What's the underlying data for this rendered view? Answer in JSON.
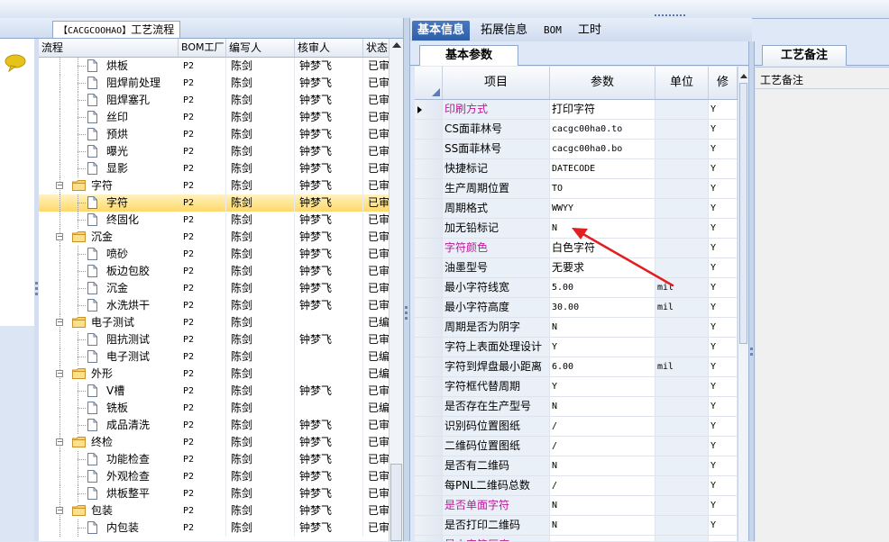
{
  "left_panel": {
    "tab_title_code": "【CACGCOOHAO】",
    "tab_title_text": "工艺流程",
    "columns": [
      "流程",
      "BOM工厂",
      "编写人",
      "核审人",
      "状态"
    ],
    "rows": [
      {
        "level": 2,
        "type": "doc",
        "name": "烘板",
        "bom": "P2",
        "author": "陈剑",
        "reviewer": "钟梦飞",
        "status": "已审"
      },
      {
        "level": 2,
        "type": "doc",
        "name": "阻焊前处理",
        "bom": "P2",
        "author": "陈剑",
        "reviewer": "钟梦飞",
        "status": "已审"
      },
      {
        "level": 2,
        "type": "doc",
        "name": "阻焊塞孔",
        "bom": "P2",
        "author": "陈剑",
        "reviewer": "钟梦飞",
        "status": "已审"
      },
      {
        "level": 2,
        "type": "doc",
        "name": "丝印",
        "bom": "P2",
        "author": "陈剑",
        "reviewer": "钟梦飞",
        "status": "已审"
      },
      {
        "level": 2,
        "type": "doc",
        "name": "预烘",
        "bom": "P2",
        "author": "陈剑",
        "reviewer": "钟梦飞",
        "status": "已审"
      },
      {
        "level": 2,
        "type": "doc",
        "name": "曝光",
        "bom": "P2",
        "author": "陈剑",
        "reviewer": "钟梦飞",
        "status": "已审"
      },
      {
        "level": 2,
        "type": "doc",
        "name": "显影",
        "bom": "P2",
        "author": "陈剑",
        "reviewer": "钟梦飞",
        "status": "已审"
      },
      {
        "level": 1,
        "type": "folder",
        "name": "字符",
        "bom": "P2",
        "author": "陈剑",
        "reviewer": "钟梦飞",
        "status": "已审"
      },
      {
        "level": 2,
        "type": "doc",
        "name": "字符",
        "bom": "P2",
        "author": "陈剑",
        "reviewer": "钟梦飞",
        "status": "已审",
        "selected": true
      },
      {
        "level": 2,
        "type": "doc",
        "name": "终固化",
        "bom": "P2",
        "author": "陈剑",
        "reviewer": "钟梦飞",
        "status": "已审"
      },
      {
        "level": 1,
        "type": "folder",
        "name": "沉金",
        "bom": "P2",
        "author": "陈剑",
        "reviewer": "钟梦飞",
        "status": "已审"
      },
      {
        "level": 2,
        "type": "doc",
        "name": "喷砂",
        "bom": "P2",
        "author": "陈剑",
        "reviewer": "钟梦飞",
        "status": "已审"
      },
      {
        "level": 2,
        "type": "doc",
        "name": "板边包胶",
        "bom": "P2",
        "author": "陈剑",
        "reviewer": "钟梦飞",
        "status": "已审"
      },
      {
        "level": 2,
        "type": "doc",
        "name": "沉金",
        "bom": "P2",
        "author": "陈剑",
        "reviewer": "钟梦飞",
        "status": "已审"
      },
      {
        "level": 2,
        "type": "doc",
        "name": "水洗烘干",
        "bom": "P2",
        "author": "陈剑",
        "reviewer": "钟梦飞",
        "status": "已审"
      },
      {
        "level": 1,
        "type": "folder",
        "name": "电子测试",
        "bom": "P2",
        "author": "陈剑",
        "reviewer": "",
        "status": "已编"
      },
      {
        "level": 2,
        "type": "doc",
        "name": "阻抗测试",
        "bom": "P2",
        "author": "陈剑",
        "reviewer": "钟梦飞",
        "status": "已审"
      },
      {
        "level": 2,
        "type": "doc",
        "name": "电子测试",
        "bom": "P2",
        "author": "陈剑",
        "reviewer": "",
        "status": "已编"
      },
      {
        "level": 1,
        "type": "folder",
        "name": "外形",
        "bom": "P2",
        "author": "陈剑",
        "reviewer": "",
        "status": "已编"
      },
      {
        "level": 2,
        "type": "doc",
        "name": "V槽",
        "bom": "P2",
        "author": "陈剑",
        "reviewer": "钟梦飞",
        "status": "已审"
      },
      {
        "level": 2,
        "type": "doc",
        "name": "铣板",
        "bom": "P2",
        "author": "陈剑",
        "reviewer": "",
        "status": "已编"
      },
      {
        "level": 2,
        "type": "doc",
        "name": "成品清洗",
        "bom": "P2",
        "author": "陈剑",
        "reviewer": "钟梦飞",
        "status": "已审"
      },
      {
        "level": 1,
        "type": "folder",
        "name": "终检",
        "bom": "P2",
        "author": "陈剑",
        "reviewer": "钟梦飞",
        "status": "已审"
      },
      {
        "level": 2,
        "type": "doc",
        "name": "功能检查",
        "bom": "P2",
        "author": "陈剑",
        "reviewer": "钟梦飞",
        "status": "已审"
      },
      {
        "level": 2,
        "type": "doc",
        "name": "外观检查",
        "bom": "P2",
        "author": "陈剑",
        "reviewer": "钟梦飞",
        "status": "已审"
      },
      {
        "level": 2,
        "type": "doc",
        "name": "烘板整平",
        "bom": "P2",
        "author": "陈剑",
        "reviewer": "钟梦飞",
        "status": "已审"
      },
      {
        "level": 1,
        "type": "folder",
        "name": "包装",
        "bom": "P2",
        "author": "陈剑",
        "reviewer": "钟梦飞",
        "status": "已审"
      },
      {
        "level": 2,
        "type": "doc",
        "name": "内包装",
        "bom": "P2",
        "author": "陈剑",
        "reviewer": "钟梦飞",
        "status": "已审"
      }
    ]
  },
  "middle_panel": {
    "tabs": [
      {
        "label": "基本信息",
        "active": true
      },
      {
        "label": "拓展信息",
        "active": false
      },
      {
        "label": "BOM",
        "active": false
      },
      {
        "label": "工时",
        "active": false
      }
    ],
    "subtab": "基本参数",
    "columns": [
      "项目",
      "参数",
      "单位",
      "修"
    ],
    "rows": [
      {
        "item": "印刷方式",
        "value": "打印字符",
        "unit": "",
        "edit": "Y",
        "pink": true,
        "current": true
      },
      {
        "item": "CS面菲林号",
        "value": "cacgc00ha0.to",
        "unit": "",
        "edit": "Y"
      },
      {
        "item": "SS面菲林号",
        "value": "cacgc00ha0.bo",
        "unit": "",
        "edit": "Y"
      },
      {
        "item": "快捷标记",
        "value": "DATECODE",
        "unit": "",
        "edit": "Y"
      },
      {
        "item": "生产周期位置",
        "value": "TO",
        "unit": "",
        "edit": "Y"
      },
      {
        "item": "周期格式",
        "value": "WWYY",
        "unit": "",
        "edit": "Y"
      },
      {
        "item": "加无铅标记",
        "value": "N",
        "unit": "",
        "edit": "Y"
      },
      {
        "item": "字符颜色",
        "value": "白色字符",
        "unit": "",
        "edit": "Y",
        "pink": true
      },
      {
        "item": "油墨型号",
        "value": "无要求",
        "unit": "",
        "edit": "Y"
      },
      {
        "item": "最小字符线宽",
        "value": "5.00",
        "unit": "mil",
        "edit": "Y"
      },
      {
        "item": "最小字符高度",
        "value": "30.00",
        "unit": "mil",
        "edit": "Y"
      },
      {
        "item": "周期是否为阴字",
        "value": "N",
        "unit": "",
        "edit": "Y"
      },
      {
        "item": "字符上表面处理设计",
        "value": "Y",
        "unit": "",
        "edit": "Y"
      },
      {
        "item": "字符到焊盘最小距离",
        "value": "6.00",
        "unit": "mil",
        "edit": "Y"
      },
      {
        "item": "字符框代替周期",
        "value": "Y",
        "unit": "",
        "edit": "Y"
      },
      {
        "item": "是否存在生产型号",
        "value": "N",
        "unit": "",
        "edit": "Y"
      },
      {
        "item": "识别码位置图纸",
        "value": "/",
        "unit": "",
        "edit": "Y"
      },
      {
        "item": "二维码位置图纸",
        "value": "/",
        "unit": "",
        "edit": "Y"
      },
      {
        "item": "是否有二维码",
        "value": "N",
        "unit": "",
        "edit": "Y"
      },
      {
        "item": "每PNL二维码总数",
        "value": "/",
        "unit": "",
        "edit": "Y"
      },
      {
        "item": "是否单面字符",
        "value": "N",
        "unit": "",
        "edit": "Y",
        "pink": true
      },
      {
        "item": "是否打印二维码",
        "value": "N",
        "unit": "",
        "edit": "Y"
      },
      {
        "item": "最小字符厚度",
        "value": "/",
        "unit": "",
        "edit": "Y",
        "pink": true
      }
    ]
  },
  "right_panel": {
    "tab": "工艺备注",
    "label": "工艺备注"
  },
  "colors": {
    "pink_text": "#c0179a",
    "selected_row": "#ffd86a",
    "active_tab": "#2d5ea8",
    "annotation_arrow": "#e02020"
  },
  "icons": [
    "chat-bubble-icon",
    "folder-icon",
    "document-icon",
    "tree-collapse-icon",
    "row-pointer-icon",
    "scroll-up-icon",
    "red-arrow-annotation"
  ]
}
